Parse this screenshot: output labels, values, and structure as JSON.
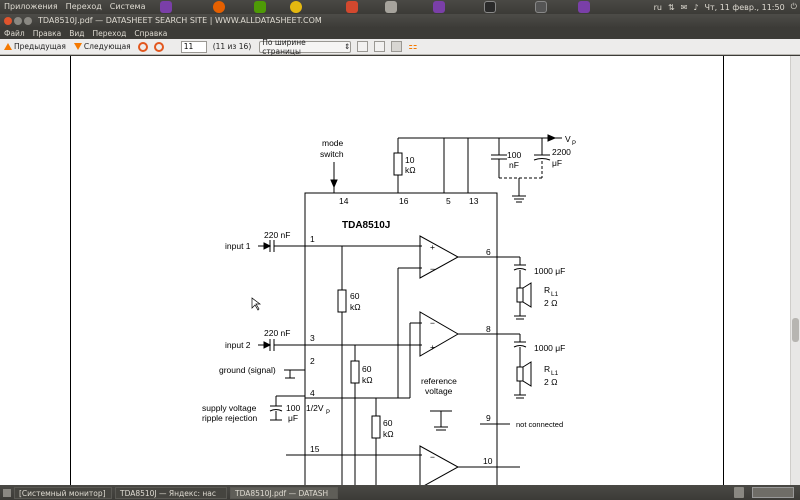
{
  "top_panel": {
    "menus": [
      "Приложения",
      "Переход",
      "Система"
    ],
    "tray": {
      "lang": "ru",
      "datetime": "Чт, 11 февр., 11:50"
    }
  },
  "window": {
    "title": "TDA8510J.pdf — DATASHEET SEARCH SITE | WWW.ALLDATASHEET.COM"
  },
  "menubar": [
    "Файл",
    "Правка",
    "Вид",
    "Переход",
    "Справка"
  ],
  "toolbar": {
    "prev_label": "Предыдущая",
    "next_label": "Следующая",
    "page_value": "11",
    "page_count": "(11 из 16)",
    "zoom": "По ширине страницы"
  },
  "schematic": {
    "chip_name": "TDA8510J",
    "vp_label": "V",
    "vp_sub": "P",
    "mode_switch": [
      "mode",
      "switch"
    ],
    "r_top": [
      "10",
      "kΩ"
    ],
    "c_100": [
      "100",
      "nF"
    ],
    "c_2200": [
      "2200",
      "μF"
    ],
    "pins": {
      "p14": "14",
      "p16": "16",
      "p5": "5",
      "p13": "13",
      "p1": "1",
      "p3": "3",
      "p2": "2",
      "p4": "4",
      "p15": "15",
      "p6": "6",
      "p8": "8",
      "p9": "9",
      "p10": "10"
    },
    "input1_cap": "220 nF",
    "input1": "input 1",
    "input2_cap": "220 nF",
    "input2": "input 2",
    "ground": "ground (signal)",
    "supply": [
      "supply voltage",
      "ripple rejection"
    ],
    "c_supply": [
      "100",
      "μF"
    ],
    "half_vp": "1/2V",
    "half_vp_sub": "P",
    "r60a": [
      "60",
      "kΩ"
    ],
    "r60b": [
      "60",
      "kΩ"
    ],
    "r60c": [
      "60",
      "kΩ"
    ],
    "ref_voltage": [
      "reference",
      "voltage"
    ],
    "not_connected": "not connected",
    "c_out1": "1000 μF",
    "rl1": [
      "R",
      "L1",
      "2 Ω"
    ],
    "c_out2": "1000 μF",
    "rl2": [
      "R",
      "L1",
      "2 Ω"
    ]
  },
  "taskbar": [
    {
      "label": "[Системный монитор]",
      "active": false
    },
    {
      "label": "TDA8510J — Яндекс: нас",
      "active": false
    },
    {
      "label": "TDA8510J.pdf — DATASH",
      "active": true
    }
  ]
}
